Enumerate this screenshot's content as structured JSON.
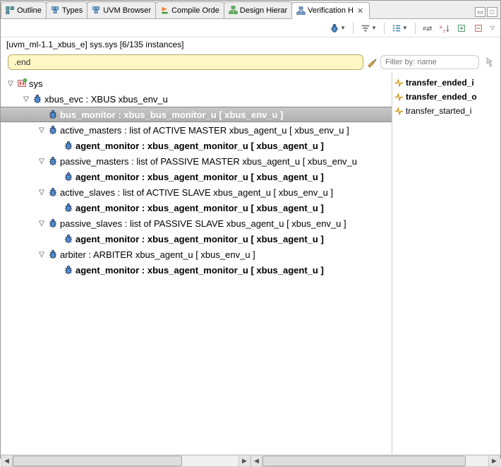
{
  "tabs": [
    {
      "label": "Outline",
      "icon": "outline"
    },
    {
      "label": "Types",
      "icon": "types"
    },
    {
      "label": "UVM Browser",
      "icon": "types"
    },
    {
      "label": "Compile Orde",
      "icon": "compile"
    },
    {
      "label": "Design Hierar",
      "icon": "design"
    },
    {
      "label": "Verification H",
      "icon": "verif",
      "active": true
    }
  ],
  "breadcrumb": "[uvm_ml-1.1_xbus_e] sys.sys [6/135 instances]",
  "search_value": ".end",
  "filter_placeholder": "Filter by: name",
  "tree": [
    {
      "indent": 0,
      "twisty": "▽",
      "icon": "sys",
      "label": "sys",
      "bold": false
    },
    {
      "indent": 1,
      "twisty": "▽",
      "icon": "unit",
      "label": "xbus_evc : XBUS xbus_env_u",
      "bold": false
    },
    {
      "indent": 2,
      "twisty": "",
      "icon": "unit",
      "label": "bus_monitor : xbus_bus_monitor_u [ xbus_env_u ]",
      "bold": true,
      "selected": true
    },
    {
      "indent": 2,
      "twisty": "▽",
      "icon": "unit",
      "label": "active_masters : list of ACTIVE MASTER xbus_agent_u [ xbus_env_u ]",
      "bold": false
    },
    {
      "indent": 3,
      "twisty": "",
      "icon": "unit",
      "label": "agent_monitor : xbus_agent_monitor_u [ xbus_agent_u ]",
      "bold": true
    },
    {
      "indent": 2,
      "twisty": "▽",
      "icon": "unit",
      "label": "passive_masters : list of PASSIVE MASTER xbus_agent_u [ xbus_env_u",
      "bold": false
    },
    {
      "indent": 3,
      "twisty": "",
      "icon": "unit",
      "label": "agent_monitor : xbus_agent_monitor_u [ xbus_agent_u ]",
      "bold": true
    },
    {
      "indent": 2,
      "twisty": "▽",
      "icon": "unit",
      "label": "active_slaves : list of ACTIVE SLAVE xbus_agent_u [ xbus_env_u ]",
      "bold": false
    },
    {
      "indent": 3,
      "twisty": "",
      "icon": "unit",
      "label": "agent_monitor : xbus_agent_monitor_u [ xbus_agent_u ]",
      "bold": true
    },
    {
      "indent": 2,
      "twisty": "▽",
      "icon": "unit",
      "label": "passive_slaves : list of PASSIVE SLAVE xbus_agent_u [ xbus_env_u ]",
      "bold": false
    },
    {
      "indent": 3,
      "twisty": "",
      "icon": "unit",
      "label": "agent_monitor : xbus_agent_monitor_u [ xbus_agent_u ]",
      "bold": true
    },
    {
      "indent": 2,
      "twisty": "▽",
      "icon": "unit",
      "label": "arbiter : ARBITER xbus_agent_u [ xbus_env_u ]",
      "bold": false
    },
    {
      "indent": 3,
      "twisty": "",
      "icon": "unit",
      "label": "agent_monitor : xbus_agent_monitor_u [ xbus_agent_u ]",
      "bold": true
    }
  ],
  "side_items": [
    {
      "label": "transfer_ended_i",
      "bold": true
    },
    {
      "label": "transfer_ended_o",
      "bold": true
    },
    {
      "label": "transfer_started_i",
      "bold": false
    }
  ]
}
